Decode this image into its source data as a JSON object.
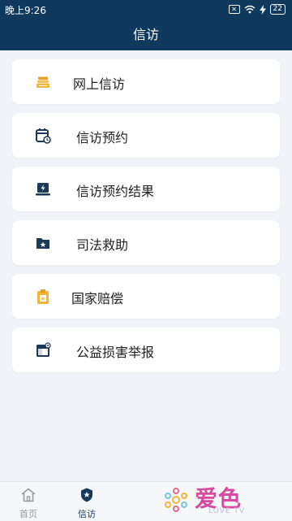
{
  "status_bar": {
    "time": "晚上9:26",
    "battery": "22"
  },
  "header": {
    "title": "信访"
  },
  "menu": {
    "items": [
      {
        "label": "网上信访",
        "icon": "book-stack-icon"
      },
      {
        "label": "信访预约",
        "icon": "calendar-clock-icon"
      },
      {
        "label": "信访预约结果",
        "icon": "laptop-bolt-icon"
      },
      {
        "label": "司法救助",
        "icon": "folder-star-icon"
      },
      {
        "label": "国家赔偿",
        "icon": "clipboard-badge-icon"
      },
      {
        "label": "公益损害举报",
        "icon": "window-report-icon"
      }
    ]
  },
  "bottom_nav": {
    "items": [
      {
        "label": "首页",
        "icon": "home-icon",
        "active": false
      },
      {
        "label": "信访",
        "icon": "shield-star-icon",
        "active": true
      }
    ]
  },
  "watermark": {
    "text": "爱色",
    "sub": "LOVE TV"
  },
  "colors": {
    "header_bg": "#0f3a5e",
    "icon_dark": "#1b3a57",
    "icon_gold": "#f2b53a",
    "active_nav": "#173a5c",
    "inactive_nav": "#9a9a9a"
  }
}
